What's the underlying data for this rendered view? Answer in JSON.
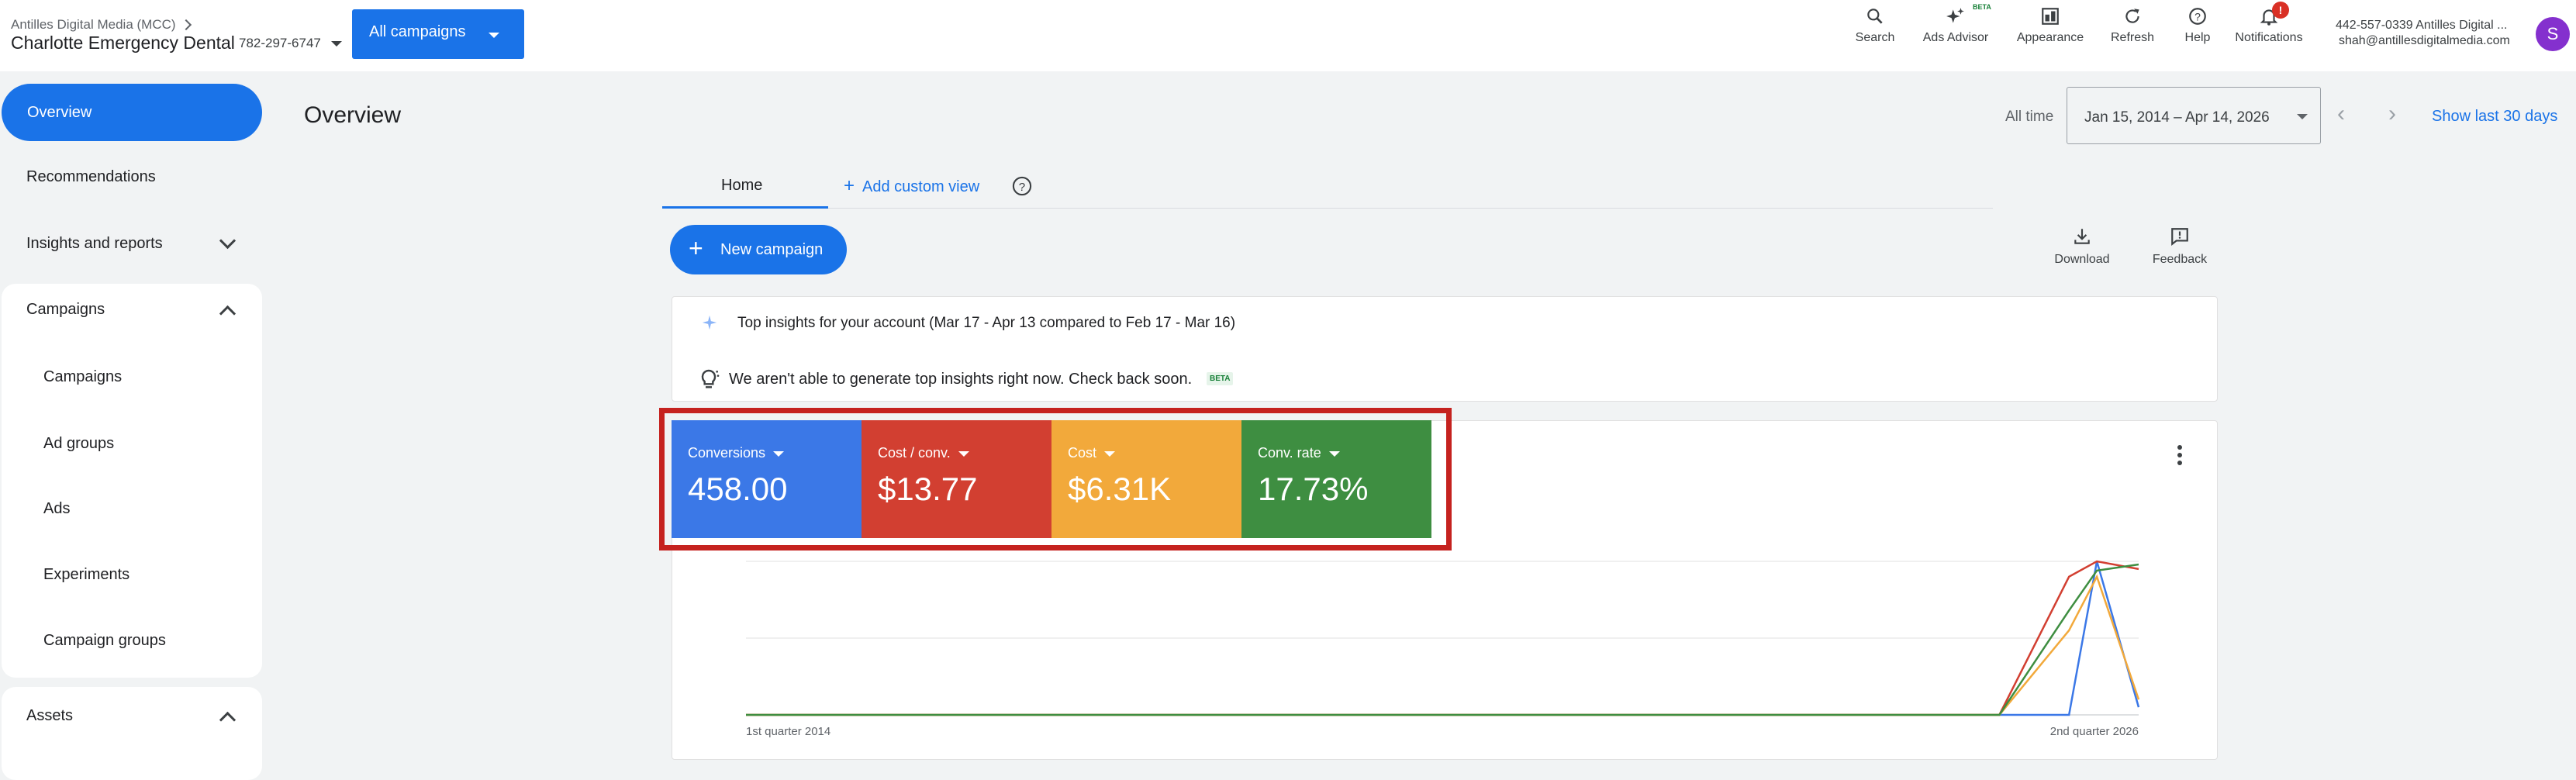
{
  "header": {
    "parent_account": "Antilles Digital Media (MCC)",
    "account_name": "Charlotte Emergency Dental",
    "account_id": "782-297-6747",
    "campaign_selector": "All campaigns",
    "tools": [
      {
        "label": "Search",
        "icon": "search-icon"
      },
      {
        "label": "Ads Advisor",
        "icon": "sparkle-icon",
        "badge": "BETA"
      },
      {
        "label": "Appearance",
        "icon": "appearance-icon"
      },
      {
        "label": "Refresh",
        "icon": "refresh-icon"
      },
      {
        "label": "Help",
        "icon": "help-icon"
      },
      {
        "label": "Notifications",
        "icon": "bell-icon",
        "badge": "!"
      }
    ],
    "account_line1": "442-557-0339 Antilles Digital ...",
    "account_email": "shah@antillesdigitalmedia.com",
    "avatar_letter": "S"
  },
  "sidebar": {
    "overview": "Overview",
    "recommendations": "Recommendations",
    "insights": "Insights and reports",
    "campaigns_section": "Campaigns",
    "campaigns_items": [
      "Campaigns",
      "Ad groups",
      "Ads",
      "Experiments",
      "Campaign groups"
    ],
    "assets_section": "Assets"
  },
  "main": {
    "title": "Overview",
    "date_label": "All time",
    "date_range": "Jan 15, 2014 – Apr 14, 2026",
    "last30": "Show last 30 days",
    "tab_home": "Home",
    "add_view": "Add custom view",
    "new_campaign": "New campaign",
    "download": "Download",
    "feedback": "Feedback",
    "insight_heading": "Top insights for your account (Mar 17 - Apr 13 compared to Feb 17 - Mar 16)",
    "insight_message": "We aren't able to generate top insights right now. Check back soon.",
    "insight_badge": "BETA"
  },
  "metrics": [
    {
      "label": "Conversions",
      "value": "458.00",
      "color": "#3b78e7"
    },
    {
      "label": "Cost / conv.",
      "value": "$13.77",
      "color": "#d23f31"
    },
    {
      "label": "Cost",
      "value": "$6.31K",
      "color": "#f2a93b"
    },
    {
      "label": "Conv. rate",
      "value": "17.73%",
      "color": "#3e8e41"
    }
  ],
  "chart_data": {
    "type": "line",
    "x_labels": [
      "1st quarter 2014",
      "2nd quarter 2026"
    ],
    "x": [
      0,
      0.9,
      0.95,
      0.97,
      1.0
    ],
    "series": [
      {
        "color": "#3b78e7",
        "values": [
          0,
          0,
          0,
          1,
          0.05
        ]
      },
      {
        "color": "#d23f31",
        "values": [
          0,
          0,
          0.9,
          1,
          0.95
        ]
      },
      {
        "color": "#f2a93b",
        "values": [
          0,
          0,
          0.55,
          0.9,
          0.1
        ]
      },
      {
        "color": "#3e8e41",
        "values": [
          0,
          0,
          0.68,
          0.94,
          0.98
        ]
      }
    ],
    "grid": true
  }
}
